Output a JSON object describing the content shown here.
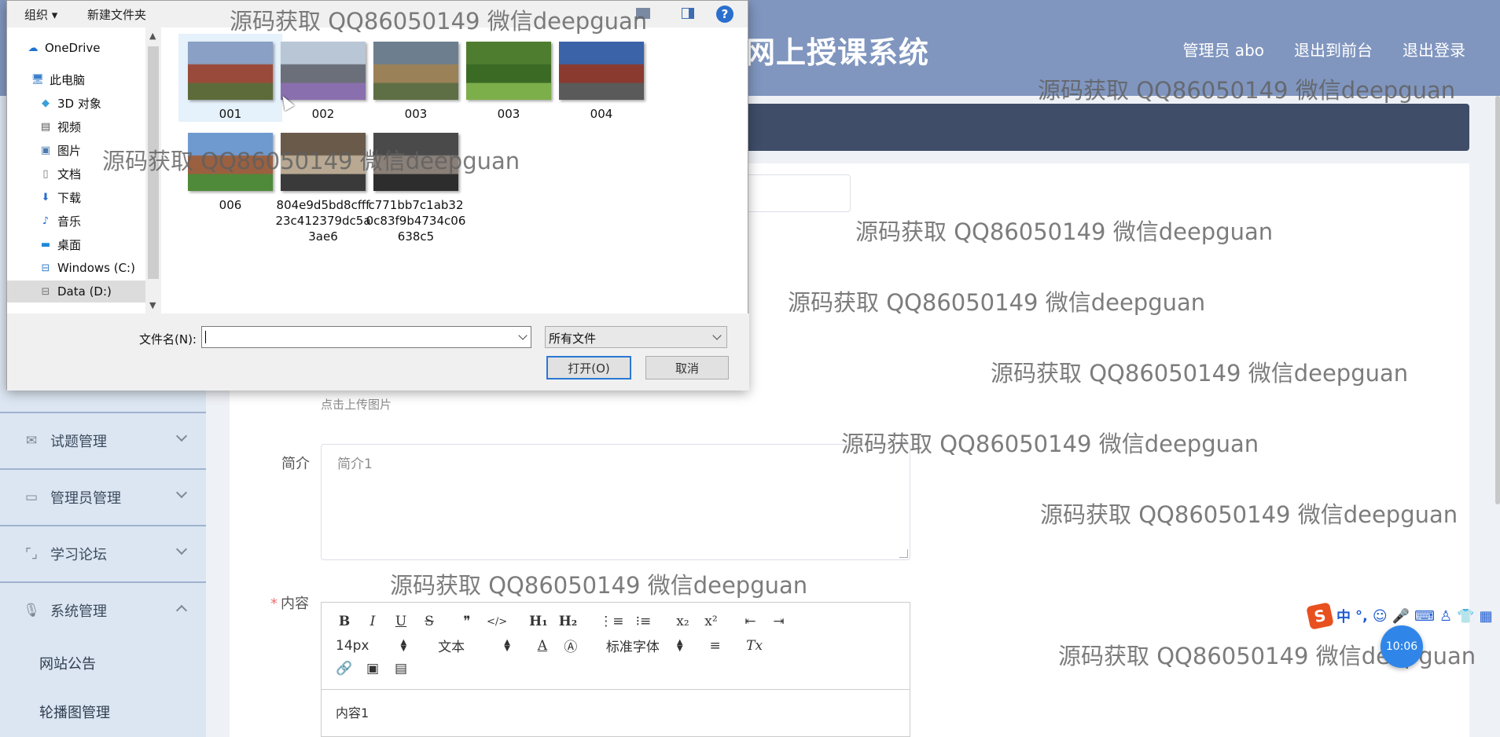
{
  "app": {
    "title": "网上授课系统",
    "visible_title": "网上授课系统",
    "header_nav": [
      "管理员 abo",
      "退出到前台",
      "退出登录"
    ]
  },
  "sidebar": {
    "items": [
      {
        "label": "试题管理",
        "icon": "mail-icon"
      },
      {
        "label": "管理员管理",
        "icon": "id-card-icon"
      },
      {
        "label": "学习论坛",
        "icon": "frame-icon"
      },
      {
        "label": "系统管理",
        "icon": "microphone-icon"
      }
    ],
    "subitems": [
      "网站公告",
      "轮播图管理"
    ]
  },
  "form": {
    "upload_hint": "点击上传图片",
    "intro_label": "简介",
    "intro_value": "简介1",
    "content_label": "内容",
    "content_required_mark": "*",
    "content_value": "内容1"
  },
  "editor": {
    "toolbar_row1": [
      "B",
      "I",
      "U",
      "S",
      "❞",
      "</>",
      "H₁",
      "H₂",
      "⋮≡",
      "⁝≡",
      "x₂",
      "x²",
      "⇤",
      "⇥"
    ],
    "font_size": "14px",
    "block_type": "文本",
    "font_family": "标准字体",
    "align_icon": "≡",
    "clear_icon": "Tx",
    "toolbar_row3": [
      "🔗",
      "▣",
      "▤"
    ]
  },
  "file_dialog": {
    "toolbar": {
      "organize": "组织 ▾",
      "new_folder": "新建文件夹",
      "help": "?"
    },
    "nav_items": [
      {
        "label": "OneDrive",
        "icon": "cloud-icon"
      },
      {
        "label": "此电脑",
        "icon": "computer-icon"
      },
      {
        "label": "3D 对象",
        "icon": "cube-icon"
      },
      {
        "label": "视频",
        "icon": "video-icon"
      },
      {
        "label": "图片",
        "icon": "picture-icon"
      },
      {
        "label": "文档",
        "icon": "document-icon"
      },
      {
        "label": "下载",
        "icon": "download-icon"
      },
      {
        "label": "音乐",
        "icon": "music-icon"
      },
      {
        "label": "桌面",
        "icon": "desktop-icon"
      },
      {
        "label": "Windows (C:)",
        "icon": "drive-icon"
      },
      {
        "label": "Data (D:)",
        "icon": "drive-icon"
      }
    ],
    "files": [
      {
        "name": "001",
        "palette": [
          "#8aa0c4",
          "#9a4a3a",
          "#5d6b3a"
        ]
      },
      {
        "name": "002",
        "palette": [
          "#b9c6d6",
          "#6b6f7a",
          "#8a6fae"
        ]
      },
      {
        "name": "003",
        "palette": [
          "#6d7f8f",
          "#9a8157",
          "#5e6f45"
        ]
      },
      {
        "name": "003",
        "palette": [
          "#4f7d2f",
          "#3b6a25",
          "#7cae4a"
        ]
      },
      {
        "name": "004",
        "palette": [
          "#3a63a8",
          "#8a3a2f",
          "#5a5a5a"
        ]
      },
      {
        "name": "006",
        "palette": [
          "#6f9ad0",
          "#9a6040",
          "#4f8a3a"
        ]
      },
      {
        "name": "804e9d5bd8cfff23c412379dc5a3ae6",
        "palette": [
          "#6a5a4a",
          "#b9a993",
          "#3a3a3a"
        ]
      },
      {
        "name": "c771bb7c1ab320c83f9b4734c06638c5",
        "palette": [
          "#4a4a4a",
          "#8a8078",
          "#2d2d2d"
        ]
      }
    ],
    "file_name_label": "文件名(N):",
    "file_name_value": "",
    "file_type": "所有文件",
    "open_button": "打开(O)",
    "cancel_button": "取消"
  },
  "watermark": "源码获取 QQ86050149 微信deepguan",
  "ime": {
    "logo": "S",
    "items": [
      "中",
      "°,",
      "☺",
      "🎤",
      "⌨",
      "♙",
      "👕",
      "▦"
    ]
  },
  "clock": "10:06",
  "colors": {
    "header_bg": "#8096bf",
    "sidebar_bg": "#dce6f2",
    "breadcrumb_bg": "#3f4d68",
    "accent": "#2b78d4",
    "required": "#f56c6c"
  }
}
